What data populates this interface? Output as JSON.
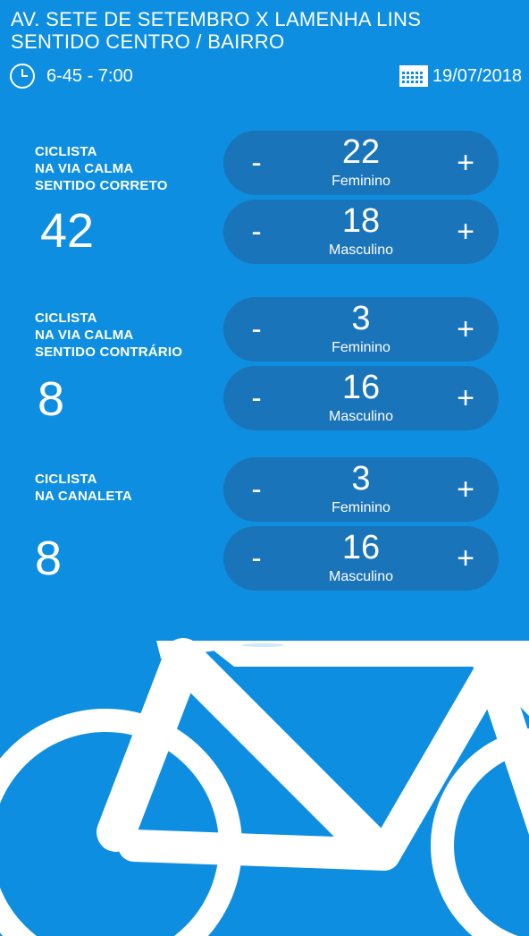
{
  "header": {
    "title_line1": "AV. SETE DE SETEMBRO X LAMENHA LINS",
    "title_line2": "SENTIDO CENTRO / BAIRRO",
    "time_range": "6-45 - 7:00",
    "date": "19/07/2018"
  },
  "icons": {
    "clock": "clock-icon",
    "calendar": "calendar-icon",
    "background": "bicycle-illustration"
  },
  "colors": {
    "background": "#0e8ee0",
    "counter_pill": "#1a74b9",
    "text": "#ffffff"
  },
  "sections": [
    {
      "label_lines": [
        "CICLISTA",
        "NA VIA CALMA",
        "SENTIDO CORRETO"
      ],
      "total": "42",
      "counters": [
        {
          "value": "22",
          "label": "Feminino",
          "minus": "-",
          "plus": "+"
        },
        {
          "value": "18",
          "label": "Masculino",
          "minus": "-",
          "plus": "+"
        }
      ]
    },
    {
      "label_lines": [
        "CICLISTA",
        "NA VIA CALMA",
        "SENTIDO CONTRÁRIO"
      ],
      "total": "8",
      "counters": [
        {
          "value": "3",
          "label": "Feminino",
          "minus": "-",
          "plus": "+"
        },
        {
          "value": "16",
          "label": "Masculino",
          "minus": "-",
          "plus": "+"
        }
      ]
    },
    {
      "label_lines": [
        "CICLISTA",
        "NA CANALETA"
      ],
      "total": "8",
      "counters": [
        {
          "value": "3",
          "label": "Feminino",
          "minus": "-",
          "plus": "+"
        },
        {
          "value": "16",
          "label": "Masculino",
          "minus": "-",
          "plus": "+"
        }
      ]
    }
  ]
}
